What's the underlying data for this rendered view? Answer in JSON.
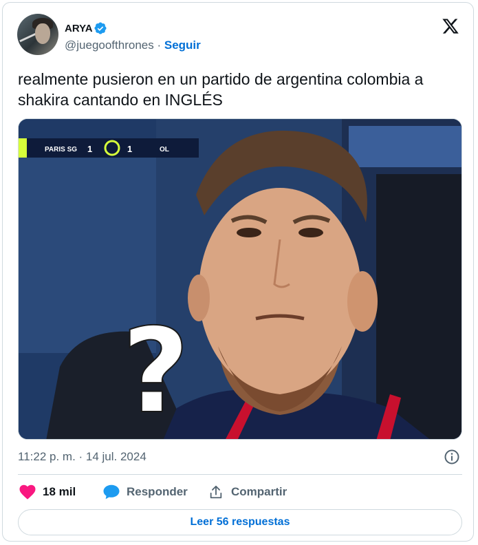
{
  "author": {
    "name": "ARYA",
    "handle": "@juegoofthrones",
    "separator": "·",
    "follow_label": "Seguir",
    "verified_icon": "verified-badge-icon"
  },
  "tweet": {
    "text": "realmente pusieron en un partido de argentina colombia a shakira cantando en INGLÉS"
  },
  "media": {
    "scoreboard": {
      "home_team": "PARIS SG",
      "home_score": "1",
      "away_score": "1",
      "away_team": "OL"
    },
    "overlay_symbol": "?"
  },
  "timestamp": "11:22 p. m. · 14 jul. 2024",
  "actions": {
    "like_count": "18 mil",
    "reply_label": "Responder",
    "share_label": "Compartir"
  },
  "read_replies_label": "Leer 56 respuestas",
  "colors": {
    "link_blue": "#006fd6",
    "like_pink": "#f91880",
    "reply_blue": "#1d9bf0",
    "muted_text": "#536471"
  }
}
